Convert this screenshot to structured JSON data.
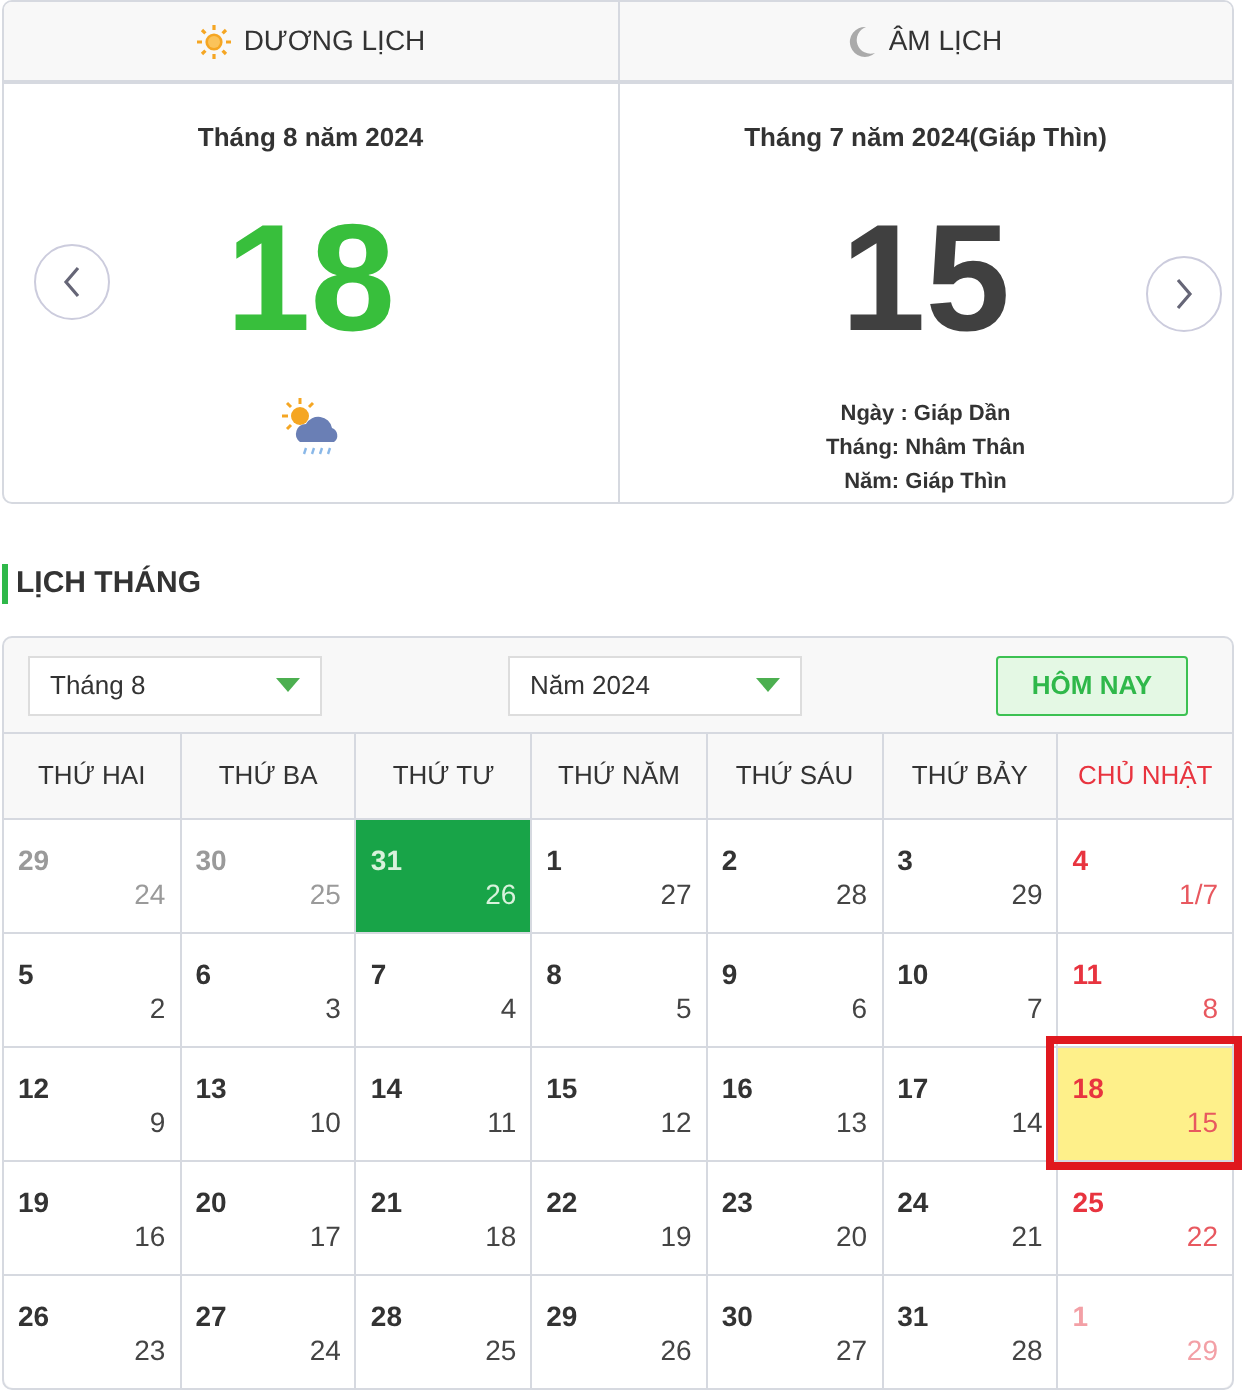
{
  "tabs": [
    {
      "label": "DƯƠNG LỊCH",
      "kind": "sun"
    },
    {
      "label": "ÂM LỊCH",
      "kind": "moon"
    }
  ],
  "solar": {
    "heading": "Tháng 8 năm 2024",
    "day": "18"
  },
  "lunar": {
    "heading": "Tháng 7 năm 2024(Giáp Thìn)",
    "day": "15",
    "details": [
      "Ngày : Giáp Dần",
      "Tháng: Nhâm Thân",
      "Năm: Giáp Thìn"
    ]
  },
  "section_title": "LỊCH THÁNG",
  "month_select": {
    "value": "Tháng 8"
  },
  "year_select": {
    "value": "Năm 2024"
  },
  "today_button": "HÔM NAY",
  "weekdays": [
    {
      "label": "THỨ HAI",
      "sunday": false
    },
    {
      "label": "THỨ BA",
      "sunday": false
    },
    {
      "label": "THỨ TƯ",
      "sunday": false
    },
    {
      "label": "THỨ NĂM",
      "sunday": false
    },
    {
      "label": "THỨ SÁU",
      "sunday": false
    },
    {
      "label": "THỨ BẢY",
      "sunday": false
    },
    {
      "label": "CHỦ NHẬT",
      "sunday": true
    }
  ],
  "weeks": [
    [
      {
        "solar": "29",
        "lunar": "24",
        "other_month": true,
        "selected": false,
        "today": false
      },
      {
        "solar": "30",
        "lunar": "25",
        "other_month": true,
        "selected": false,
        "today": false
      },
      {
        "solar": "31",
        "lunar": "26",
        "other_month": true,
        "selected": true,
        "today": false
      },
      {
        "solar": "1",
        "lunar": "27",
        "other_month": false,
        "selected": false,
        "today": false
      },
      {
        "solar": "2",
        "lunar": "28",
        "other_month": false,
        "selected": false,
        "today": false
      },
      {
        "solar": "3",
        "lunar": "29",
        "other_month": false,
        "selected": false,
        "today": false
      },
      {
        "solar": "4",
        "lunar": "1/7",
        "other_month": false,
        "selected": false,
        "today": false
      }
    ],
    [
      {
        "solar": "5",
        "lunar": "2",
        "other_month": false,
        "selected": false,
        "today": false
      },
      {
        "solar": "6",
        "lunar": "3",
        "other_month": false,
        "selected": false,
        "today": false
      },
      {
        "solar": "7",
        "lunar": "4",
        "other_month": false,
        "selected": false,
        "today": false
      },
      {
        "solar": "8",
        "lunar": "5",
        "other_month": false,
        "selected": false,
        "today": false
      },
      {
        "solar": "9",
        "lunar": "6",
        "other_month": false,
        "selected": false,
        "today": false
      },
      {
        "solar": "10",
        "lunar": "7",
        "other_month": false,
        "selected": false,
        "today": false
      },
      {
        "solar": "11",
        "lunar": "8",
        "other_month": false,
        "selected": false,
        "today": false
      }
    ],
    [
      {
        "solar": "12",
        "lunar": "9",
        "other_month": false,
        "selected": false,
        "today": false
      },
      {
        "solar": "13",
        "lunar": "10",
        "other_month": false,
        "selected": false,
        "today": false
      },
      {
        "solar": "14",
        "lunar": "11",
        "other_month": false,
        "selected": false,
        "today": false
      },
      {
        "solar": "15",
        "lunar": "12",
        "other_month": false,
        "selected": false,
        "today": false
      },
      {
        "solar": "16",
        "lunar": "13",
        "other_month": false,
        "selected": false,
        "today": false
      },
      {
        "solar": "17",
        "lunar": "14",
        "other_month": false,
        "selected": false,
        "today": false
      },
      {
        "solar": "18",
        "lunar": "15",
        "other_month": false,
        "selected": false,
        "today": true
      }
    ],
    [
      {
        "solar": "19",
        "lunar": "16",
        "other_month": false,
        "selected": false,
        "today": false
      },
      {
        "solar": "20",
        "lunar": "17",
        "other_month": false,
        "selected": false,
        "today": false
      },
      {
        "solar": "21",
        "lunar": "18",
        "other_month": false,
        "selected": false,
        "today": false
      },
      {
        "solar": "22",
        "lunar": "19",
        "other_month": false,
        "selected": false,
        "today": false
      },
      {
        "solar": "23",
        "lunar": "20",
        "other_month": false,
        "selected": false,
        "today": false
      },
      {
        "solar": "24",
        "lunar": "21",
        "other_month": false,
        "selected": false,
        "today": false
      },
      {
        "solar": "25",
        "lunar": "22",
        "other_month": false,
        "selected": false,
        "today": false
      }
    ],
    [
      {
        "solar": "26",
        "lunar": "23",
        "other_month": false,
        "selected": false,
        "today": false
      },
      {
        "solar": "27",
        "lunar": "24",
        "other_month": false,
        "selected": false,
        "today": false
      },
      {
        "solar": "28",
        "lunar": "25",
        "other_month": false,
        "selected": false,
        "today": false
      },
      {
        "solar": "29",
        "lunar": "26",
        "other_month": false,
        "selected": false,
        "today": false
      },
      {
        "solar": "30",
        "lunar": "27",
        "other_month": false,
        "selected": false,
        "today": false
      },
      {
        "solar": "31",
        "lunar": "28",
        "other_month": false,
        "selected": false,
        "today": false
      },
      {
        "solar": "1",
        "lunar": "29",
        "other_month": true,
        "selected": false,
        "today": false
      }
    ]
  ]
}
